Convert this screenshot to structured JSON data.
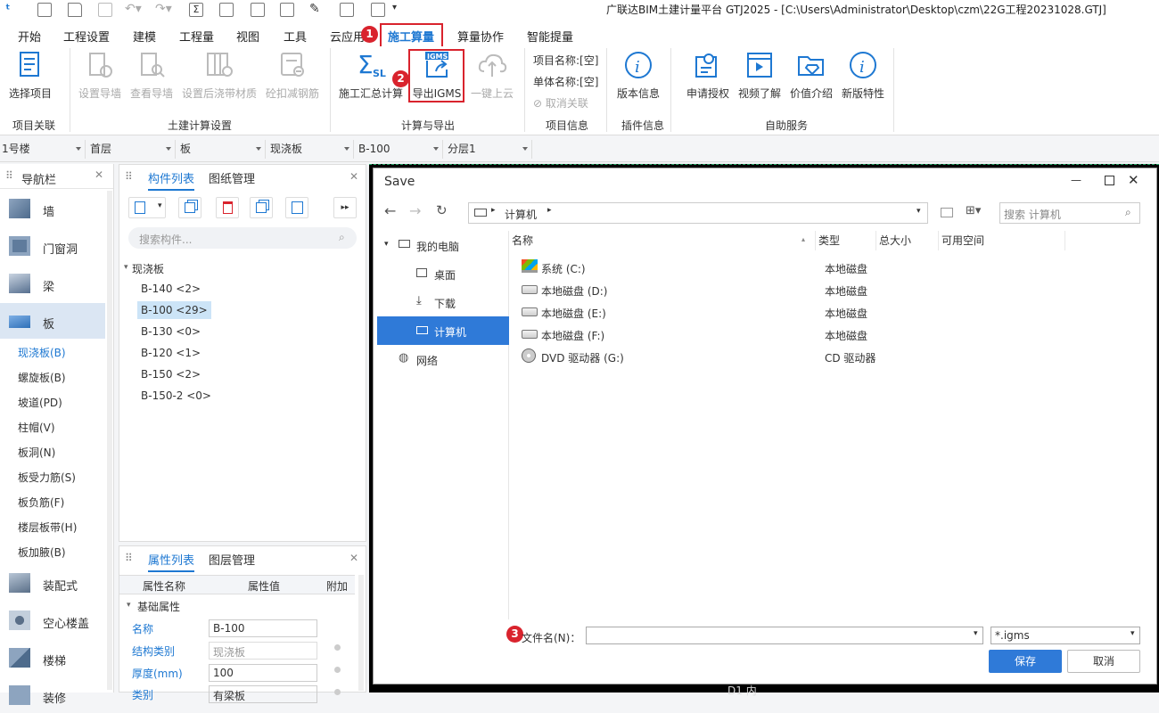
{
  "title": "广联达BIM土建计量平台 GTJ2025 - [C:\\Users\\Administrator\\Desktop\\czm\\22G工程20231028.GTJ]",
  "menu": [
    "开始",
    "工程设置",
    "建模",
    "工程量",
    "视图",
    "工具",
    "云应用",
    "施工算量",
    "算量协作",
    "智能提量"
  ],
  "ribbon": {
    "select_project": "选择项目",
    "set_guide_wall": "设置导墙",
    "view_guide_wall": "查看导墙",
    "set_post_pour": "设置后浇带材质",
    "rebar_reduce": "砼扣减钢筋",
    "summary_calc": "施工汇总计算",
    "export_igms": "导出IGMS",
    "upload": "一键上云",
    "project_name": "项目名称:[空]",
    "unit_name": "单体名称:[空]",
    "cancel_link": "取消关联",
    "version_info": "版本信息",
    "apply_auth": "申请授权",
    "video": "视频了解",
    "price": "价值介绍",
    "new_features": "新版特性",
    "igms_label": "IGMS",
    "sl_label": "SL",
    "groups": {
      "project_link": "项目关联",
      "civil_settings": "土建计算设置",
      "calc_export": "计算与导出",
      "project_info": "项目信息",
      "plugin_info": "插件信息",
      "self_service": "自助服务"
    }
  },
  "selectors": [
    "1号楼",
    "首层",
    "板",
    "现浇板",
    "B-100",
    "分层1"
  ],
  "nav": {
    "title": "导航栏",
    "cats_top": [
      "墙",
      "门窗洞",
      "梁",
      "板"
    ],
    "subs": [
      "现浇板(B)",
      "螺旋板(B)",
      "坡道(PD)",
      "柱帽(V)",
      "板洞(N)",
      "板受力筋(S)",
      "板负筋(F)",
      "楼层板带(H)",
      "板加腋(B)"
    ],
    "cats_bottom": [
      "装配式",
      "空心楼盖",
      "楼梯",
      "装修"
    ]
  },
  "components": {
    "tab1": "构件列表",
    "tab2": "图纸管理",
    "search_placeholder": "搜索构件...",
    "group": "现浇板",
    "items": [
      "B-140 <2>",
      "B-100 <29>",
      "B-130 <0>",
      "B-120 <1>",
      "B-150 <2>",
      "B-150-2 <0>"
    ]
  },
  "props": {
    "tab1": "属性列表",
    "tab2": "图层管理",
    "cols": [
      "属性名称",
      "属性值",
      "附加"
    ],
    "section": "基础属性",
    "rows": [
      {
        "name": "名称",
        "value": "B-100"
      },
      {
        "name": "结构类别",
        "value": "现浇板"
      },
      {
        "name": "厚度(mm)",
        "value": "100"
      },
      {
        "name": "类别",
        "value": "有梁板"
      }
    ]
  },
  "canvas": {
    "label": "D1 内"
  },
  "dialog": {
    "title": "Save",
    "path": "计算机",
    "search_placeholder": "搜索 计算机",
    "tree": [
      "我的电脑",
      "桌面",
      "下载",
      "计算机",
      "网络"
    ],
    "columns": [
      "名称",
      "类型",
      "总大小",
      "可用空间"
    ],
    "files": [
      {
        "name": "系统 (C:)",
        "type": "本地磁盘"
      },
      {
        "name": "本地磁盘 (D:)",
        "type": "本地磁盘"
      },
      {
        "name": "本地磁盘 (E:)",
        "type": "本地磁盘"
      },
      {
        "name": "本地磁盘 (F:)",
        "type": "本地磁盘"
      },
      {
        "name": "DVD 驱动器 (G:)",
        "type": "CD 驱动器"
      }
    ],
    "filename_label": "文件名(N)：",
    "filename_value": "",
    "filetype": "*.igms",
    "save": "保存",
    "cancel": "取消"
  },
  "badges": [
    "1",
    "2",
    "3"
  ],
  "colors": {
    "accent": "#1e78d2",
    "highlight": "#d9232d",
    "selected": "#cce4f7"
  }
}
